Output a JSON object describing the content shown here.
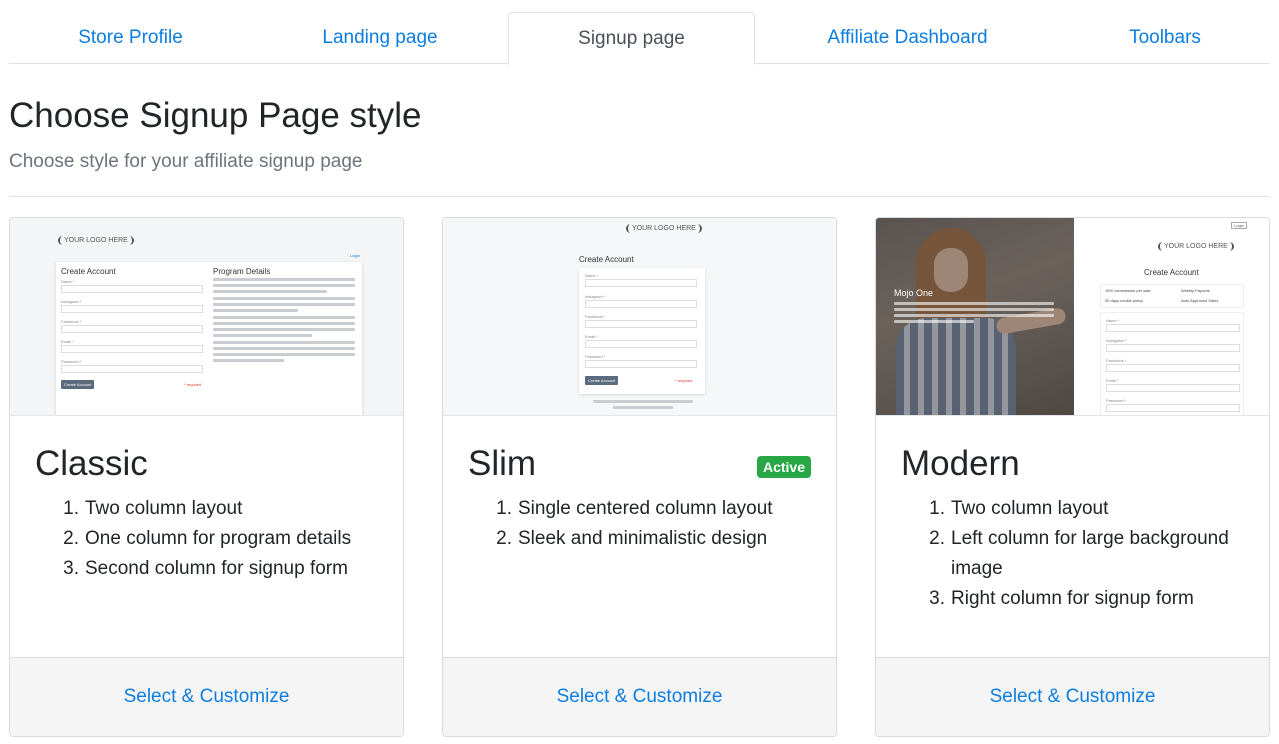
{
  "tabs": [
    {
      "label": "Store Profile",
      "active": false
    },
    {
      "label": "Landing page",
      "active": false
    },
    {
      "label": "Signup page",
      "active": true
    },
    {
      "label": "Affiliate Dashboard",
      "active": false
    },
    {
      "label": "Toolbars",
      "active": false
    }
  ],
  "page": {
    "title": "Choose Signup Page style",
    "subtitle": "Choose style for your affiliate signup page"
  },
  "colors": {
    "link": "#0d7ee0",
    "active_badge": "#28a745",
    "footer_bg": "#f5f5f5"
  },
  "cards": [
    {
      "title": "Classic",
      "features": [
        "Two column layout",
        "One column for program details",
        "Second column for signup form"
      ],
      "action_label": "Select & Customize",
      "preview": {
        "logo": "YOUR LOGO HERE",
        "login_link": "Login",
        "form_title": "Create Account",
        "details_title": "Program Details",
        "fields": [
          "Name *",
          "Instagram *",
          "Facebook *",
          "Email *",
          "Password *"
        ],
        "button": "Create Account",
        "required_note": "* required"
      }
    },
    {
      "title": "Slim",
      "badge": "Active",
      "features": [
        "Single centered column layout",
        "Sleek and minimalistic design"
      ],
      "action_label": "Select & Customize",
      "preview": {
        "logo": "YOUR LOGO HERE",
        "form_title": "Create Account",
        "fields": [
          "Name *",
          "Instagram *",
          "Facebook *",
          "Email *",
          "Password *"
        ],
        "button": "Create Account",
        "required_note": "* required"
      }
    },
    {
      "title": "Modern",
      "features": [
        "Two column layout",
        "Left column for large background image",
        "Right column for signup form"
      ],
      "action_label": "Select & Customize",
      "preview": {
        "logo": "YOUR LOGO HERE",
        "login_link": "Login",
        "brand_name": "Mojo One",
        "form_title": "Create Account",
        "perks": [
          "15% commission per sale",
          "Weekly Payouts",
          "30 days cookie policy",
          "Auto Approved Sales"
        ],
        "fields": [
          "Name *",
          "Instagram *",
          "Facebook *",
          "Email *",
          "Password *"
        ]
      }
    }
  ]
}
